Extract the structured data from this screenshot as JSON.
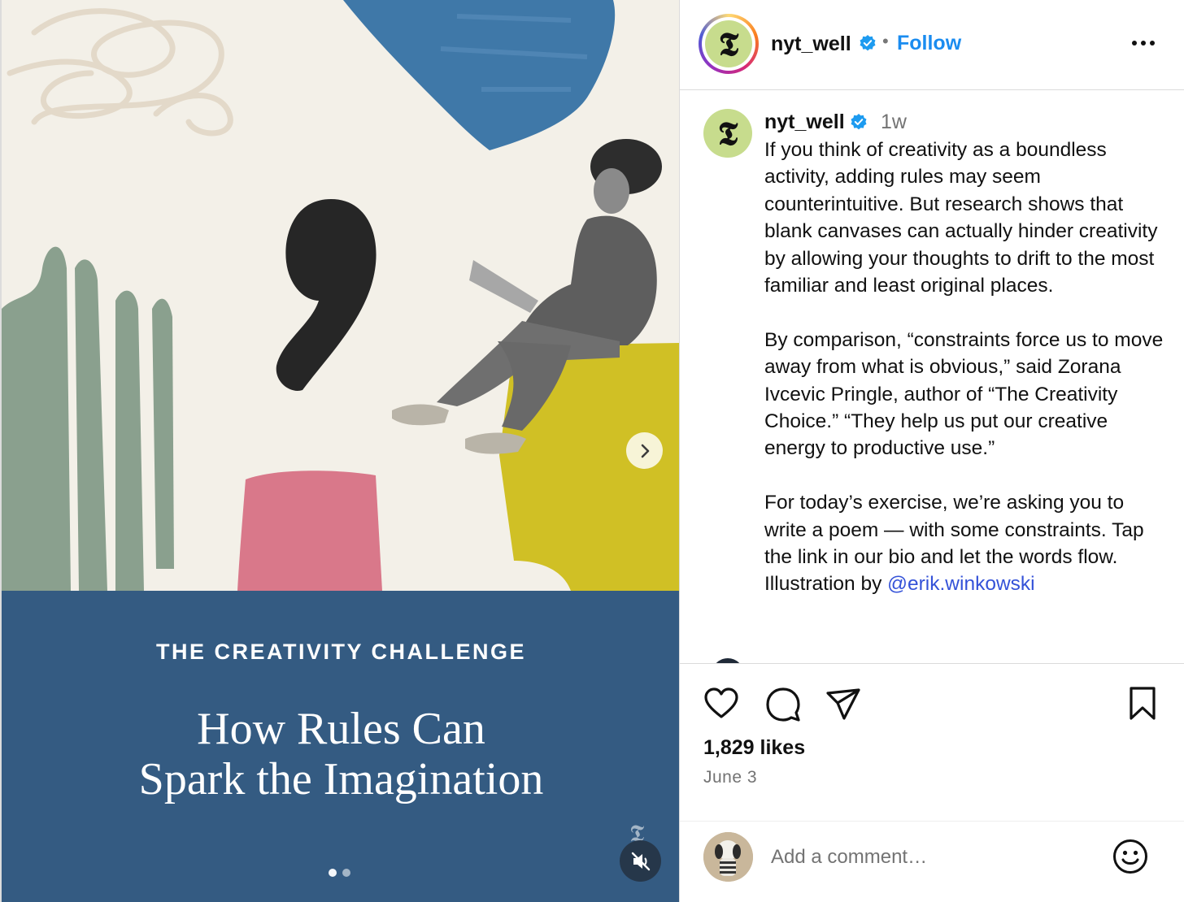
{
  "media": {
    "kicker": "THE CREATIVITY CHALLENGE",
    "headline_lines": [
      "How Rules Can",
      "Spark the Imagination"
    ],
    "watermark": "𝕿",
    "carousel": {
      "current": 1,
      "total": 2
    },
    "colors": {
      "panel": "#345b82",
      "paper": "#f3f0e8",
      "blue_stroke": "#3f78a8",
      "green_stroke": "#8aa08e",
      "pink_stroke": "#d9788a",
      "yellow_block": "#d0c025"
    }
  },
  "header": {
    "username": "nyt_well",
    "separator": "•",
    "follow_label": "Follow",
    "avatar_glyph": "𝕿"
  },
  "caption": {
    "username": "nyt_well",
    "time": "1w",
    "paragraph1": "If you think of creativity as a boundless activity, adding rules may seem counterintuitive. But research shows that blank canvases can actually hinder creativity by allowing your thoughts to drift to the most familiar and least original places.",
    "paragraph2": "By comparison, “constraints force us to move away from what is obvious,” said Zorana Ivcevic Pringle, author of “The Creativity Choice.” “They help us put our creative energy to productive use.”",
    "paragraph3_text": "For today’s exercise, we’re asking you to write a poem — with some constraints. Tap the link in our bio and let the words flow. Illustration by ",
    "mention": "@erik.winkowski"
  },
  "actions": {
    "likes": "1,829 likes",
    "date": "June 3",
    "icons": [
      "heart-icon",
      "comment-icon",
      "share-icon",
      "bookmark-icon"
    ]
  },
  "comment": {
    "placeholder": "Add a comment…",
    "emoji_icon": "smiley-icon"
  },
  "brand_colors": {
    "follow": "#1a8cf0",
    "verified": "#1d9bf0",
    "link": "#3452d8"
  }
}
